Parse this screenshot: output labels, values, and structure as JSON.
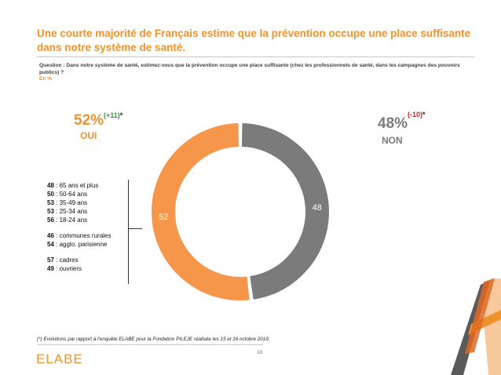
{
  "header": {
    "title": "Une courte majorité de Français estime que la prévention occupe une place suffisante dans notre système de santé.",
    "question": "Question : Dans notre système de santé, estimez-vous que la prévention occupe une place suffisante (chez les professionnels de santé, dans les campagnes des pouvoirs publics) ?",
    "unit": "En %"
  },
  "results": {
    "oui": {
      "pct": "52%",
      "evolution": "(+11)",
      "star": "*",
      "label": "OUI"
    },
    "non": {
      "pct": "48%",
      "evolution": "(-10)",
      "star": "*",
      "label": "NON"
    }
  },
  "details": [
    {
      "value": "48",
      "label": " : 65 ans et plus"
    },
    {
      "value": "50",
      "label": " : 50-64 ans"
    },
    {
      "value": "53",
      "label": " : 35-49 ans"
    },
    {
      "value": "53",
      "label": " : 25-34 ans"
    },
    {
      "value": "56",
      "label": " : 18-24 ans"
    },
    {
      "value": "46",
      "label": " : communes rurales"
    },
    {
      "value": "54",
      "label": " : agglo. parisienne"
    },
    {
      "value": "57",
      "label": " : cadres"
    },
    {
      "value": "49",
      "label": " : ouvriers"
    }
  ],
  "footer": {
    "note": "(*) Evolutions par rapport à l’enquête ELABE pour la Fondation PILEJE réalisée les 15 et 16 octobre 2019.",
    "page": "10",
    "logo": "ELABE"
  },
  "colors": {
    "orange": "#f5964a",
    "gray": "#7b7b7b",
    "accent": "#f0922b"
  },
  "chart_data": {
    "type": "pie",
    "subtype": "donut",
    "categories": [
      "OUI",
      "NON"
    ],
    "values": [
      52,
      48
    ],
    "data_labels": [
      "52",
      "48"
    ],
    "colors": [
      "#f5964a",
      "#7b7b7b"
    ]
  }
}
